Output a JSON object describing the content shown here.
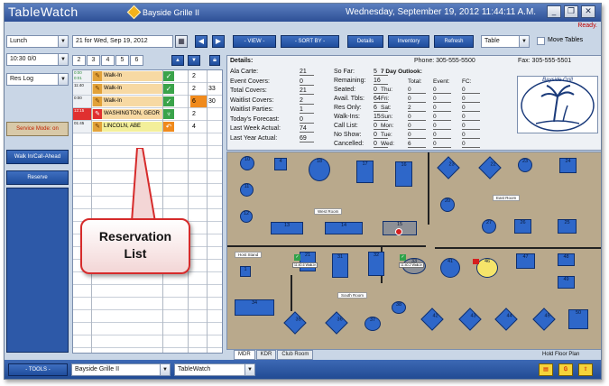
{
  "app": {
    "title": "TableWatch",
    "venue": "Bayside Grille II",
    "datetime": "Wednesday, September 19, 2012   11:44:11  A.M.",
    "status": "Ready."
  },
  "window": {
    "minimize": "_",
    "restore": "❐",
    "close": "✕"
  },
  "toolbar": {
    "meal_period": "Lunch",
    "date_label": "21 for Wed, Sep 19, 2012",
    "view_label": "- VIEW -",
    "sort_label": "- SORT BY -",
    "details_label": "Details",
    "inventory_label": "Inventory",
    "refresh_label": "Refresh",
    "display_mode": "Table",
    "move_tables_label": "Move Tables"
  },
  "sidebar": {
    "time_filter": "10:30   0/0",
    "log_mode": "Res Log",
    "service_mode": "Service Mode: on",
    "walkin_label": "Walk In/Call-Ahead",
    "reserve_label": "Reserve",
    "tools_label": "- TOOLS -"
  },
  "list_tabs": [
    "2",
    "3",
    "4",
    "5",
    "6"
  ],
  "reservations": [
    {
      "time": "0:00\n0:01",
      "name": "Walk-In",
      "party": "2",
      "table": "",
      "row_color": "#f7d9a3",
      "status_color": "#3aa34a",
      "status_glyph": "✓",
      "icon": "✎"
    },
    {
      "time": "11:40",
      "name": "Walk-In",
      "party": "2",
      "table": "33",
      "row_color": "#f7d9a3",
      "status_color": "#3aa34a",
      "status_glyph": "✓",
      "icon": "✎"
    },
    {
      "time": "0:00",
      "name": "Walk-In",
      "party": "6",
      "table": "30",
      "row_color": "#f7d9a3",
      "status_color": "#3aa34a",
      "status_glyph": "✓",
      "icon": "✎"
    },
    {
      "time": "12:15",
      "name": "WASHINGTON, GEOR",
      "party": "2",
      "table": "",
      "row_color": "#f7d9a3",
      "status_color": "#3aa34a",
      "status_glyph": "♆",
      "icon": "✎"
    },
    {
      "time": "01:45",
      "name": "LINCOLN, ABE",
      "party": "4",
      "table": "",
      "row_color": "#f3ef9a",
      "status_color": "#f08a1c",
      "status_glyph": "↶",
      "icon": "✎"
    }
  ],
  "callout": {
    "line1": "Reservation",
    "line2": "List"
  },
  "details": {
    "heading": "Details:",
    "phone": "Phone: 305-555-5500",
    "fax": "Fax: 305-555-5501",
    "col1": [
      {
        "label": "Ala Carte:",
        "value": "21"
      },
      {
        "label": "Event Covers:",
        "value": "0"
      },
      {
        "label": "Total Covers:",
        "value": "21"
      },
      {
        "label": "Waitlist Covers:",
        "value": "2"
      },
      {
        "label": "Waitlist Parties:",
        "value": "1"
      },
      {
        "label": "Today's Forecast:",
        "value": "0"
      },
      {
        "label": "Last Week Actual:",
        "value": "74"
      },
      {
        "label": "Last Year Actual:",
        "value": "69"
      }
    ],
    "col2": [
      {
        "label": "So Far:",
        "value": "5"
      },
      {
        "label": "Remaining:",
        "value": "16"
      },
      {
        "label": "Seated:",
        "value": "0"
      },
      {
        "label": "Avail. Tbls:",
        "value": "64"
      },
      {
        "label": "Res Only:",
        "value": "6"
      },
      {
        "label": "Walk-Ins:",
        "value": "15"
      },
      {
        "label": "Call List:",
        "value": "0"
      },
      {
        "label": "No Show:",
        "value": "0"
      },
      {
        "label": "Cancelled:",
        "value": "0"
      }
    ],
    "outlook": {
      "heading": "7 Day Outlook:",
      "headers": [
        "Total:",
        "Event:",
        "FC:"
      ],
      "rows": [
        {
          "day": "Thu:",
          "total": "0",
          "event": "0",
          "fc": "0"
        },
        {
          "day": "Fri:",
          "total": "0",
          "event": "0",
          "fc": "0"
        },
        {
          "day": "Sat:",
          "total": "2",
          "event": "0",
          "fc": "0"
        },
        {
          "day": "Sun:",
          "total": "0",
          "event": "0",
          "fc": "0"
        },
        {
          "day": "Mon:",
          "total": "0",
          "event": "0",
          "fc": "0"
        },
        {
          "day": "Tue:",
          "total": "0",
          "event": "0",
          "fc": "0"
        },
        {
          "day": "Wed:",
          "total": "6",
          "event": "0",
          "fc": "0"
        }
      ]
    },
    "logo_text": "Bayside Grill"
  },
  "floor": {
    "rooms": {
      "west": "West Room",
      "east": "East Room",
      "south": "South Room",
      "host": "Host Stand"
    },
    "tables": [
      "10",
      "4",
      "18",
      "17",
      "16",
      "23",
      "22",
      "23",
      "24",
      "11",
      "20",
      "12",
      "13",
      "14",
      "15",
      "27",
      "26",
      "25",
      "21",
      "31",
      "32",
      "33",
      "41",
      "46",
      "47",
      "48",
      "49",
      "1",
      "34",
      "35",
      "36",
      "37",
      "38",
      "42",
      "43",
      "44",
      "45",
      "50",
      "30"
    ],
    "tags": {
      "t30": "11:40-6 Walk-In",
      "t33": "11:40-2 Walk-In"
    },
    "room_tabs": [
      "MDR",
      "KDR",
      "Club Room"
    ],
    "hold_label": "Hold Floor Plan"
  },
  "bottom": {
    "venue_select": "Bayside Grille II",
    "app_select": "TableWatch",
    "icon1": "▤",
    "icon2": "₲",
    "icon3": "⇧"
  }
}
